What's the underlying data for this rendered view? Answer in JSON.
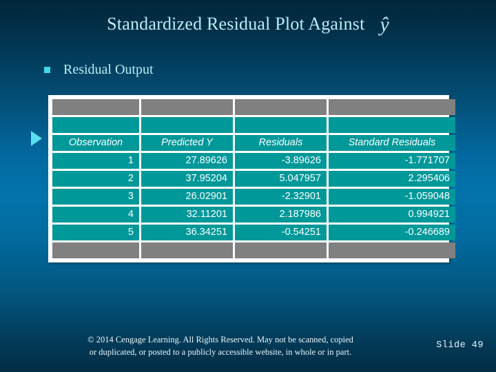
{
  "slide": {
    "title": "Standardized Residual Plot Against",
    "title_symbol": "ŷ",
    "bullet_label": "Residual Output",
    "bullet_icon": "square-bullet",
    "pointer_icon": "right-triangle-pointer",
    "slide_number_label": "Slide  49",
    "footer_line1": "© 2014  Cengage Learning.  All Rights Reserved.  May not be scanned, copied",
    "footer_line2": "or duplicated, or posted to a publicly accessible website, in whole or in part."
  },
  "colors": {
    "background_top": "#01263a",
    "background_mid": "#0273ac",
    "background_bottom": "#022d44",
    "title_text": "#b6eef5",
    "bullet_accent": "#3fd9e8",
    "pointer_accent": "#59e0f0",
    "table_cell": "#019899",
    "table_edge": "#808080",
    "table_border": "#ffffff",
    "cell_text": "#ffffff"
  },
  "table": {
    "headers": [
      "Observation",
      "Predicted Y",
      "Residuals",
      "Standard Residuals"
    ],
    "rows": [
      [
        "1",
        "27.89626",
        "-3.89626",
        "-1.771707"
      ],
      [
        "2",
        "37.95204",
        "5.047957",
        "2.295406"
      ],
      [
        "3",
        "26.02901",
        "-2.32901",
        "-1.059048"
      ],
      [
        "4",
        "32.11201",
        "2.187986",
        "0.994921"
      ],
      [
        "5",
        "36.34251",
        "-0.54251",
        "-0.246689"
      ]
    ]
  },
  "chart_data": {
    "type": "table",
    "title": "Residual Output",
    "columns": [
      "Observation",
      "Predicted Y",
      "Residuals",
      "Standard Residuals"
    ],
    "rows": [
      {
        "Observation": 1,
        "Predicted Y": 27.89626,
        "Residuals": -3.89626,
        "Standard Residuals": -1.771707
      },
      {
        "Observation": 2,
        "Predicted Y": 37.95204,
        "Residuals": 5.047957,
        "Standard Residuals": 2.295406
      },
      {
        "Observation": 3,
        "Predicted Y": 26.02901,
        "Residuals": -2.32901,
        "Standard Residuals": -1.059048
      },
      {
        "Observation": 4,
        "Predicted Y": 32.11201,
        "Residuals": 2.187986,
        "Standard Residuals": 0.994921
      },
      {
        "Observation": 5,
        "Predicted Y": 36.34251,
        "Residuals": -0.54251,
        "Standard Residuals": -0.246689
      }
    ]
  }
}
